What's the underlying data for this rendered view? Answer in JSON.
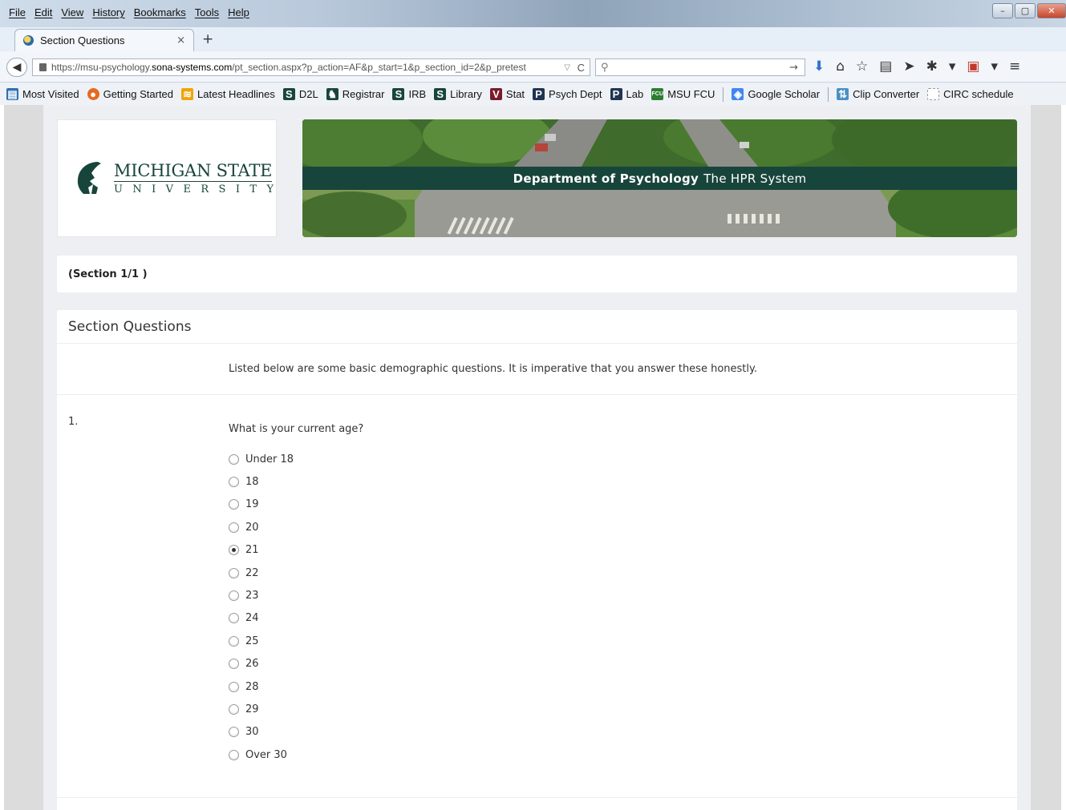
{
  "browser": {
    "menu": [
      "File",
      "Edit",
      "View",
      "History",
      "Bookmarks",
      "Tools",
      "Help"
    ],
    "tab": {
      "title": "Section Questions",
      "close": "×",
      "new_tab": "+"
    },
    "url": {
      "prefix": "https://msu-psychology.",
      "host": "sona-systems.com",
      "path": "/pt_section.aspx?p_action=AF&p_start=1&p_section_id=2&p_pretest"
    },
    "search_placeholder": "",
    "bookmarks": [
      {
        "label": "Most Visited",
        "icon": "most-visited-icon",
        "color": "#2f6fb3"
      },
      {
        "label": "Getting Started",
        "icon": "firefox-icon",
        "color": "#e66a1f"
      },
      {
        "label": "Latest Headlines",
        "icon": "rss-icon",
        "color": "#f0a30a"
      },
      {
        "label": "D2L",
        "icon": "msu-s-icon",
        "color": "#18453b"
      },
      {
        "label": "Registrar",
        "icon": "spartan-icon",
        "color": "#18453b"
      },
      {
        "label": "IRB",
        "icon": "msu-s-icon",
        "color": "#18453b"
      },
      {
        "label": "Library",
        "icon": "msu-s-icon",
        "color": "#18453b"
      },
      {
        "label": "Stat",
        "icon": "v-icon",
        "color": "#7a1b2a"
      },
      {
        "label": "Psych Dept",
        "icon": "p-icon",
        "color": "#1f3550"
      },
      {
        "label": "Lab",
        "icon": "p-icon",
        "color": "#1f3550"
      },
      {
        "label": "MSU FCU",
        "icon": "fcu-icon",
        "color": "#2e7d32"
      },
      {
        "label": "Google Scholar",
        "icon": "scholar-icon",
        "color": "#4285f4"
      },
      {
        "label": "Clip Converter",
        "icon": "clip-icon",
        "color": "#4a90c2"
      },
      {
        "label": "CIRC schedule",
        "icon": "page-icon",
        "color": "#999999"
      }
    ]
  },
  "header": {
    "msu_name": "MICHIGAN STATE",
    "msu_university": "UNIVERSITY",
    "banner_bold": "Department of Psychology",
    "banner_rest": "The HPR System"
  },
  "section": {
    "label": "(Section 1/1 )"
  },
  "questions": {
    "heading": "Section Questions",
    "intro": "Listed below are some basic demographic questions. It is imperative that you answer these honestly.",
    "q1": {
      "number": "1.",
      "text": "What is your current age?",
      "selected": "21",
      "options": [
        "Under 18",
        "18",
        "19",
        "20",
        "21",
        "22",
        "23",
        "24",
        "25",
        "26",
        "28",
        "29",
        "30",
        "Over 30"
      ]
    }
  },
  "colors": {
    "msu_green": "#18453b",
    "page_bg": "#eeeff3"
  }
}
